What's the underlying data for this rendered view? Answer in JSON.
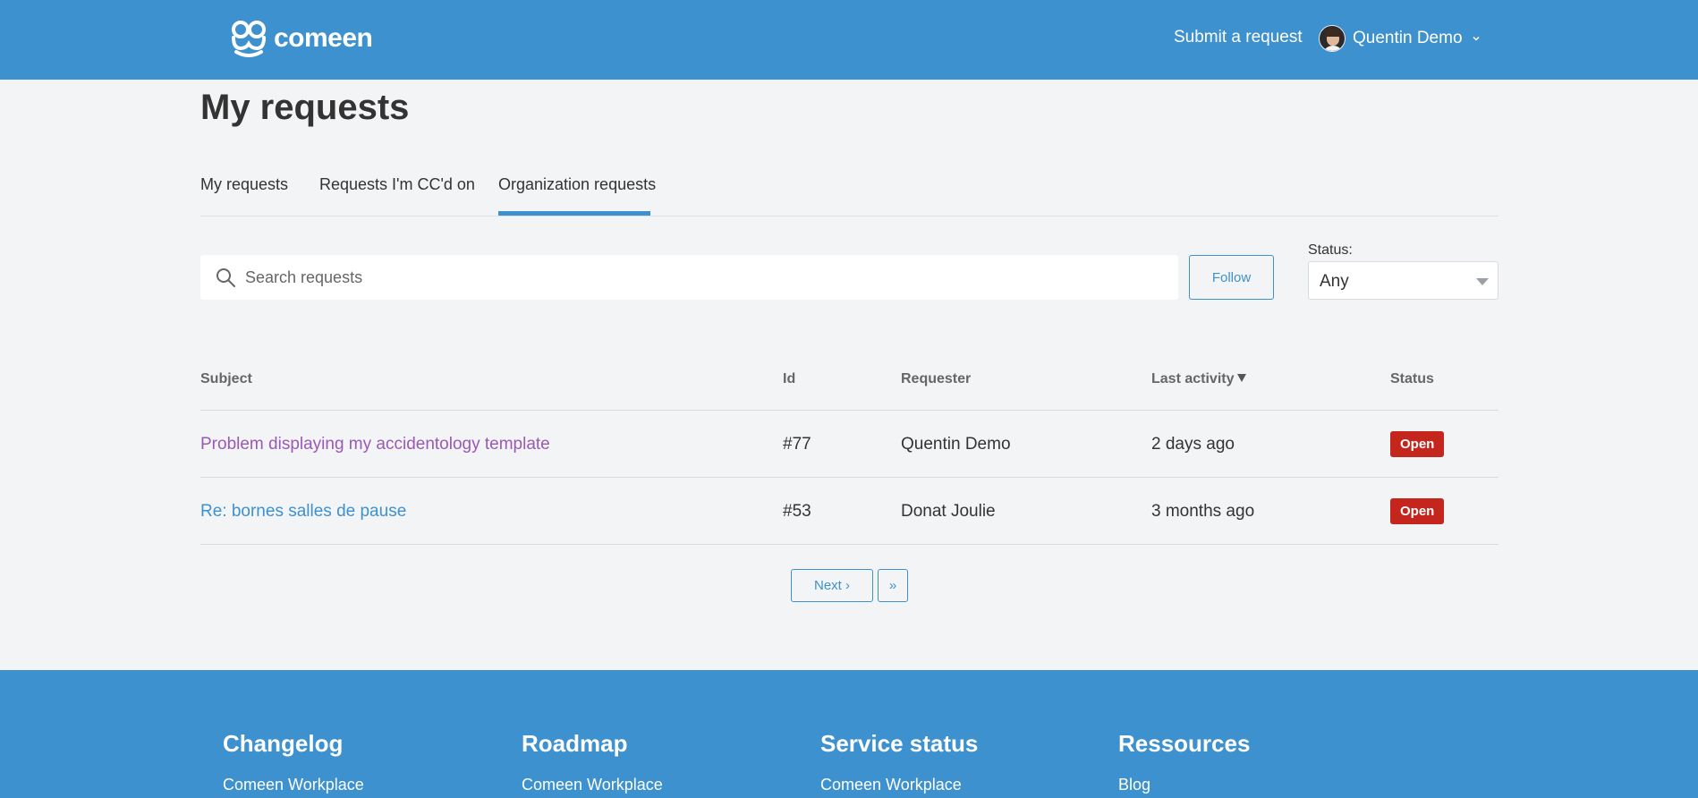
{
  "header": {
    "logo_text": "comeen",
    "submit_label": "Submit a request",
    "user_name": "Quentin Demo"
  },
  "page": {
    "title": "My requests"
  },
  "tabs": [
    {
      "label": "My requests"
    },
    {
      "label": "Requests I'm CC'd on"
    },
    {
      "label": "Organization requests"
    }
  ],
  "filters": {
    "search_placeholder": "Search requests",
    "follow_label": "Follow",
    "status_label": "Status:",
    "status_value": "Any"
  },
  "table": {
    "headers": {
      "subject": "Subject",
      "id": "Id",
      "requester": "Requester",
      "last_activity": "Last activity",
      "status": "Status"
    },
    "rows": [
      {
        "subject": "Problem displaying my accidentology template",
        "id": "#77",
        "requester": "Quentin Demo",
        "last_activity": "2 days ago",
        "status": "Open"
      },
      {
        "subject": "Re: bornes salles de pause",
        "id": "#53",
        "requester": "Donat Joulie",
        "last_activity": "3 months ago",
        "status": "Open"
      }
    ]
  },
  "pagination": {
    "next_label": "Next  ›",
    "last_label": "»"
  },
  "footer": {
    "columns": [
      {
        "title": "Changelog",
        "link": "Comeen Workplace"
      },
      {
        "title": "Roadmap",
        "link": "Comeen Workplace"
      },
      {
        "title": "Service status",
        "link": "Comeen Workplace"
      },
      {
        "title": "Ressources",
        "link": "Blog"
      }
    ]
  },
  "colors": {
    "brand_blue": "#3d91ce",
    "status_open": "#c4261e",
    "visited_link": "#9b59b6"
  }
}
